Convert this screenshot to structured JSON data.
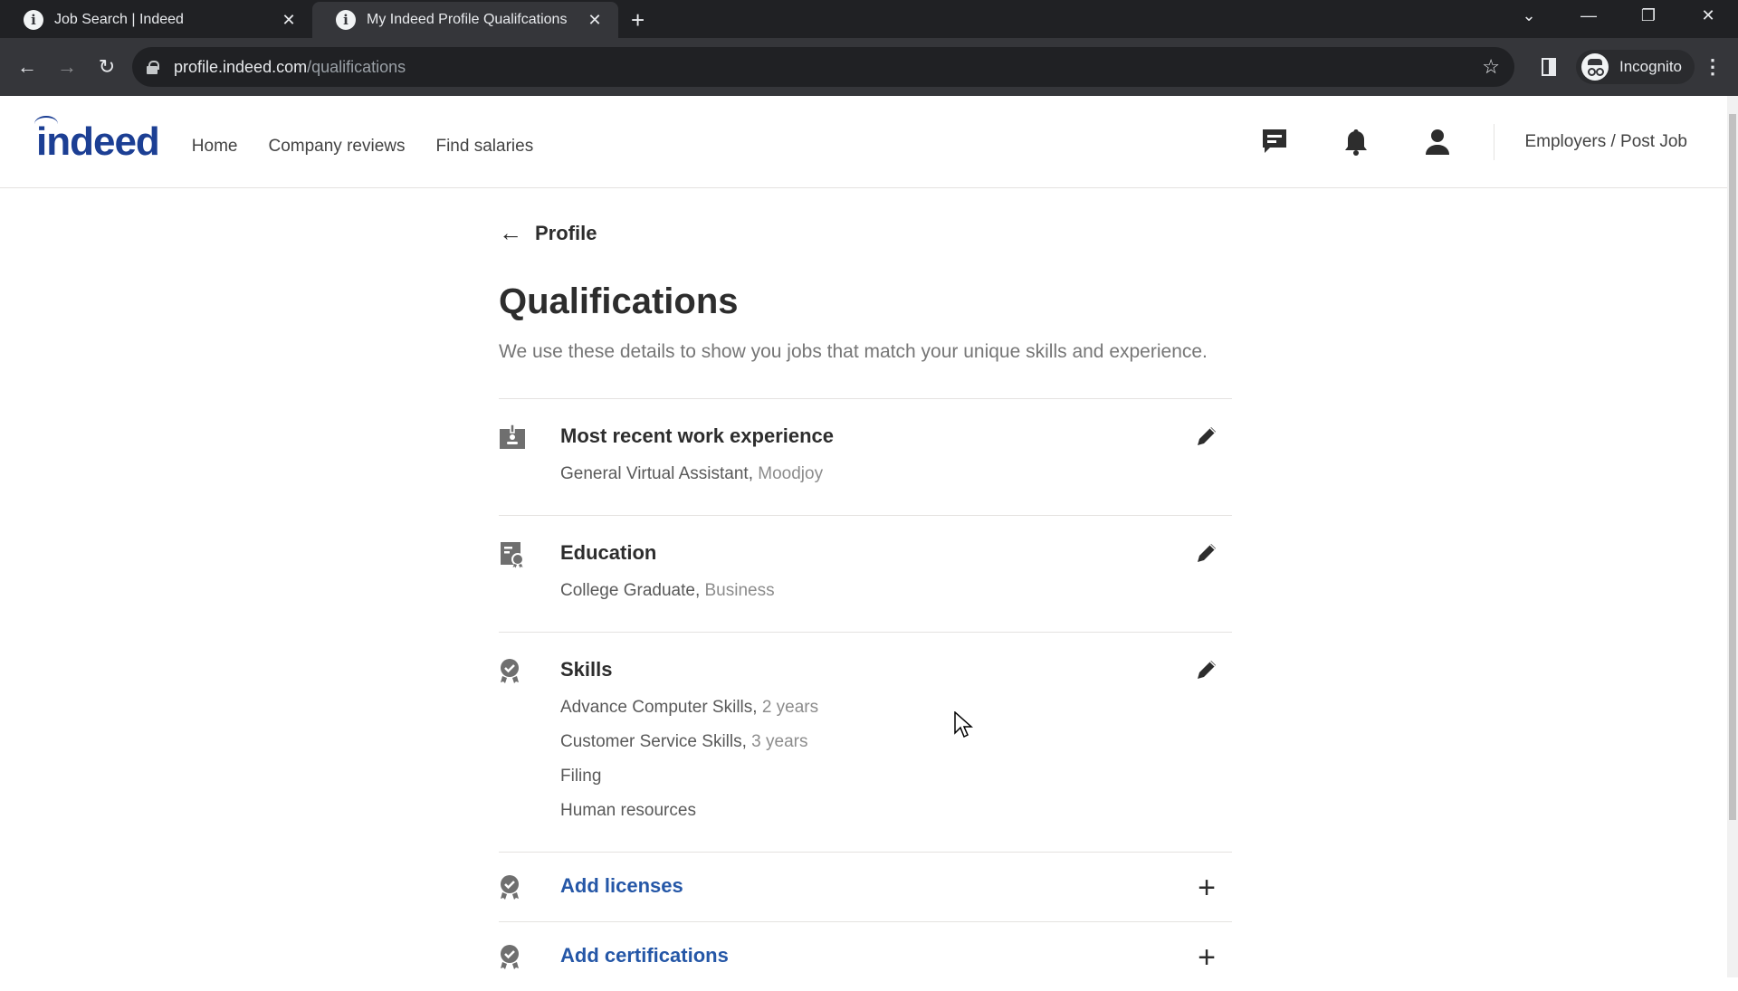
{
  "browser": {
    "tabs": [
      {
        "title": "Job Search | Indeed",
        "active": false
      },
      {
        "title": "My Indeed Profile Qualifcations",
        "active": true
      }
    ],
    "new_tab_label": "+",
    "url_host": "profile.indeed.com",
    "url_path": "/qualifications",
    "profile_label": "Incognito"
  },
  "header": {
    "logo": "indeed",
    "nav": [
      "Home",
      "Company reviews",
      "Find salaries"
    ],
    "icons": [
      "messages-icon",
      "notifications-icon",
      "account-icon"
    ],
    "employers_link": "Employers / Post Job"
  },
  "main": {
    "back_label": "Profile",
    "title": "Qualifications",
    "subtitle": "We use these details to show you jobs that match your unique skills and experience.",
    "sections": [
      {
        "icon": "work-badge-icon",
        "title": "Most recent work experience",
        "lines": [
          {
            "main": "General Virtual Assistant",
            "muted": "Moodjoy"
          }
        ],
        "action": "edit"
      },
      {
        "icon": "education-certificate-icon",
        "title": "Education",
        "lines": [
          {
            "main": "College Graduate",
            "muted": "Business"
          }
        ],
        "action": "edit"
      },
      {
        "icon": "skills-award-icon",
        "title": "Skills",
        "lines": [
          {
            "main": "Advance Computer Skills",
            "muted": "2 years"
          },
          {
            "main": "Customer Service Skills",
            "muted": "3 years"
          },
          {
            "main": "Filing",
            "muted": ""
          },
          {
            "main": "Human resources",
            "muted": ""
          }
        ],
        "action": "edit"
      }
    ],
    "add_sections": [
      {
        "icon": "licenses-award-icon",
        "label": "Add licenses"
      },
      {
        "icon": "certifications-award-icon",
        "label": "Add certifications"
      }
    ]
  },
  "colors": {
    "brand": "#1c3f94",
    "link": "#2557a7",
    "text": "#2d2d2d",
    "muted": "#767676"
  }
}
